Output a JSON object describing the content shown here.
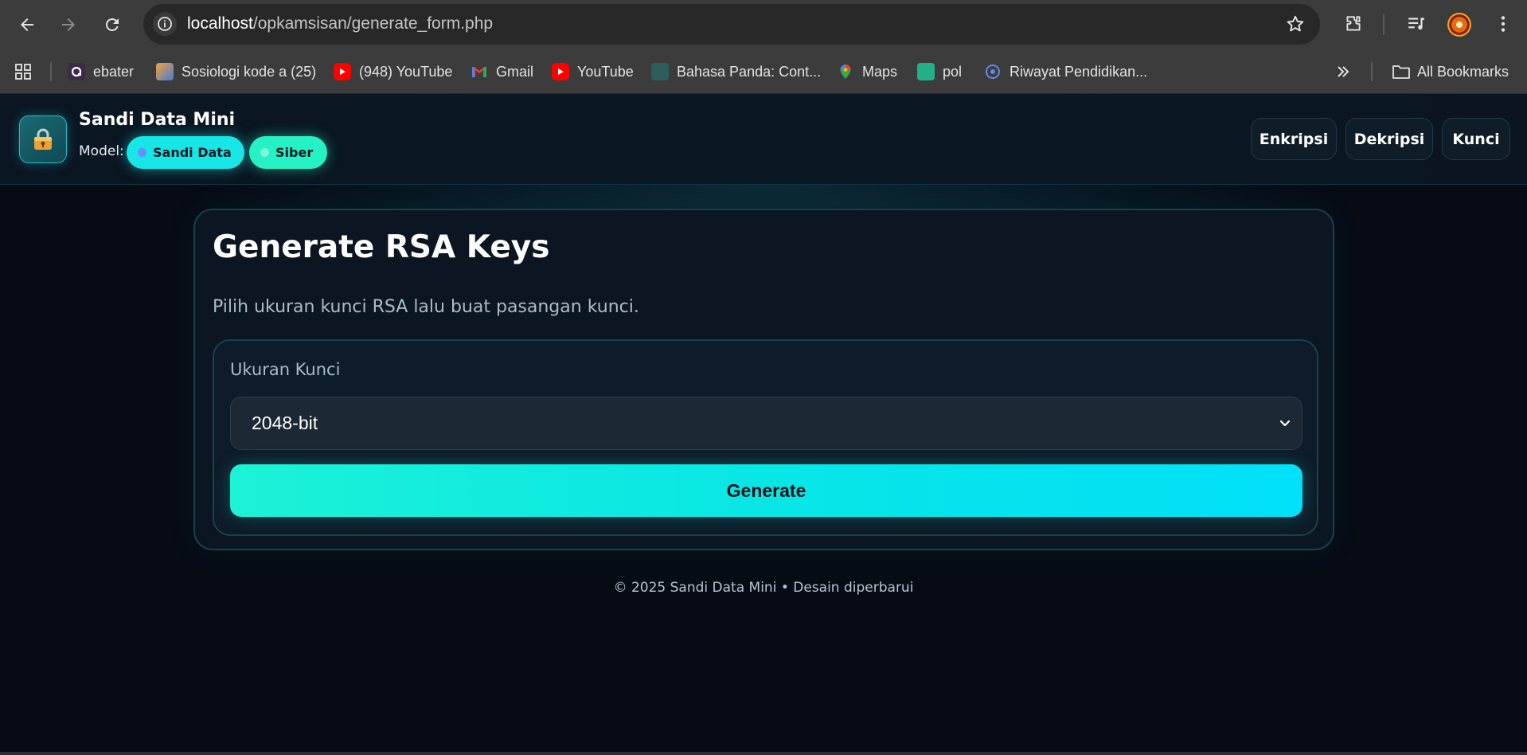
{
  "browser": {
    "url_host": "localhost",
    "url_path": "/opkamsisan/generate_form.php",
    "nav_icons": [
      "back-arrow-icon",
      "forward-arrow-icon",
      "reload-icon"
    ],
    "bookmarks": [
      {
        "label": "ebater",
        "icon": "ebater-favicon",
        "color": "#3d2a4a"
      },
      {
        "label": "Sosiologi kode a (25)",
        "icon": "sosiologi-favicon",
        "color": "#f2a33a"
      },
      {
        "label": "(948) YouTube",
        "icon": "youtube-icon",
        "color": "#ff0000"
      },
      {
        "label": "Gmail",
        "icon": "gmail-icon",
        "color": "#ea4335"
      },
      {
        "label": "YouTube",
        "icon": "youtube-icon",
        "color": "#ff0000"
      },
      {
        "label": "Bahasa Panda: Cont...",
        "icon": "bahasa-panda-favicon",
        "color": "#3f8f8a"
      },
      {
        "label": "Maps",
        "icon": "maps-icon",
        "color": "#34a853"
      },
      {
        "label": "pol",
        "icon": "pol-favicon",
        "color": "#21b089"
      },
      {
        "label": "Riwayat Pendidikan...",
        "icon": "riwayat-favicon",
        "color": "#5c8be6"
      }
    ],
    "all_bookmarks_label": "All Bookmarks"
  },
  "header": {
    "brand": "Sandi Data Mini",
    "model_label": "Model:",
    "pills": [
      {
        "label": "Sandi Data",
        "dot_color": "#6b8cff",
        "bg": "#17e6e6"
      },
      {
        "label": "Siber",
        "dot_color": "#7ff2d8",
        "bg": "#25f2c4"
      }
    ],
    "nav": [
      {
        "label": "Enkripsi"
      },
      {
        "label": "Dekripsi"
      },
      {
        "label": "Kunci"
      }
    ]
  },
  "card": {
    "title": "Generate RSA Keys",
    "subtitle": "Pilih ukuran kunci RSA lalu buat pasangan kunci.",
    "field_label": "Ukuran Kunci",
    "selected_key_size": "2048-bit",
    "generate_label": "Generate"
  },
  "footer": {
    "text": "© 2025 Sandi Data Mini • Desain diperbarui"
  },
  "colors": {
    "accent_cyan": "#17e6e6",
    "accent_teal": "#25f2c4",
    "background": "#060b14"
  }
}
